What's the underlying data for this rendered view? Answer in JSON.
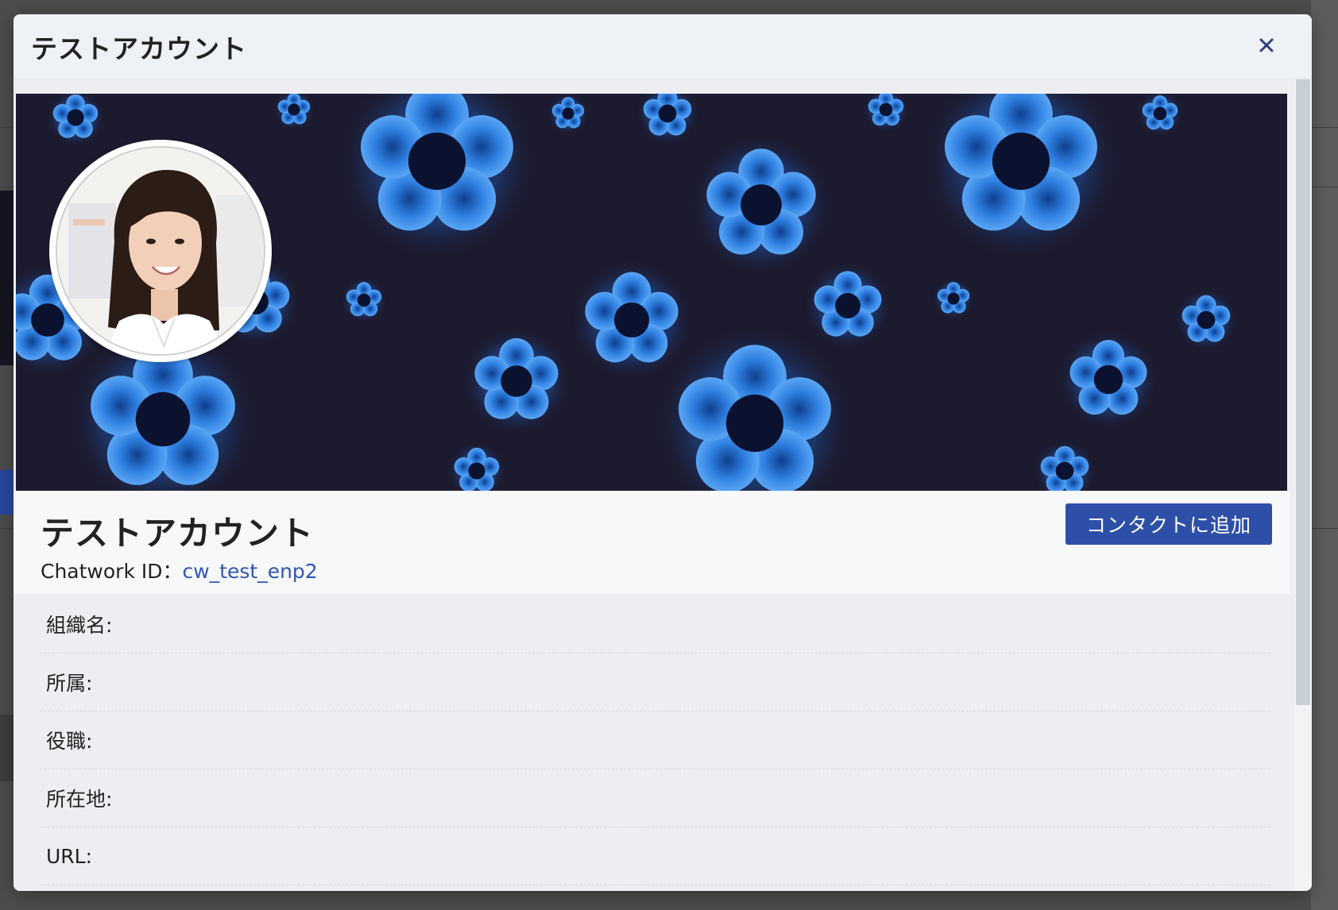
{
  "modal": {
    "title": "テストアカウント",
    "close_icon": "close-icon"
  },
  "profile": {
    "name": "テストアカウント",
    "chatwork_id_label": "Chatwork ID：",
    "chatwork_id": "cw_test_enp2",
    "add_contact_label": "コンタクトに追加",
    "avatar_icon": "avatar-photo",
    "cover_icon": "flower-pattern-cover"
  },
  "fields": [
    {
      "label": "組織名:",
      "value": ""
    },
    {
      "label": "所属:",
      "value": ""
    },
    {
      "label": "役職:",
      "value": ""
    },
    {
      "label": "所在地:",
      "value": ""
    },
    {
      "label": "URL:",
      "value": ""
    }
  ],
  "colors": {
    "accent": "#2d4fa8",
    "link": "#2f56b1",
    "cover_bg": "#1c1a2e",
    "flower": "#3f8ee8"
  }
}
